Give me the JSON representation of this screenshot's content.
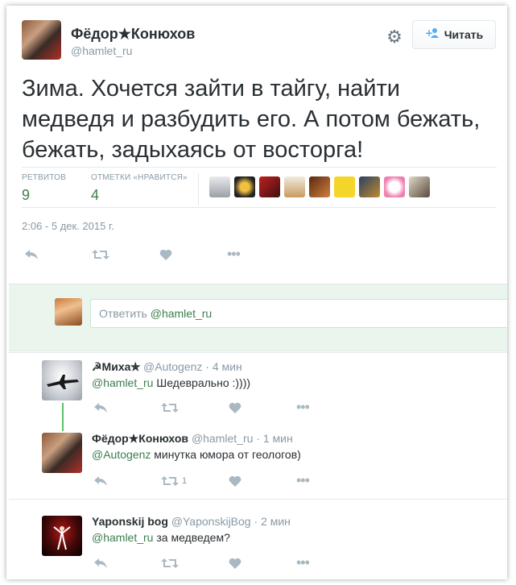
{
  "tweet": {
    "author_name": "Фёдор★Конюхов",
    "author_handle": "@hamlet_ru",
    "follow_label": "Читать",
    "text": "Зима. Хочется зайти в тайгу, найти медведя и разбудить его. А потом бежать, бежать, задыхаясь от восторга!",
    "stats": {
      "retweets_label": "РЕТВИТОВ",
      "retweets_value": "9",
      "likes_label": "ОТМЕТКИ «НРАВИТСЯ»",
      "likes_value": "4"
    },
    "timestamp": "2:06 - 5 дек. 2015 г."
  },
  "reply_box": {
    "prefix": "Ответить ",
    "mention": "@hamlet_ru"
  },
  "replies": [
    {
      "name": "☭Миха✯",
      "handle": "@Autogenz",
      "time": "· 4 мин",
      "mention": "@hamlet_ru",
      "text": " Шедеврально :))))",
      "retweet_count": ""
    },
    {
      "name": "Фёдор★Конюхов",
      "handle": "@hamlet_ru",
      "time": "· 1 мин",
      "mention": "@Autogenz",
      "text": " минутка юмора от геологов)",
      "retweet_count": "1"
    },
    {
      "name": "Yaponskij bog",
      "handle": "@YaponskijBog",
      "time": "· 2 мин",
      "mention": "@hamlet_ru",
      "text": " за медведем?",
      "retweet_count": ""
    }
  ],
  "icons": {
    "reply": "↩",
    "retweet": "⇄",
    "like": "♥",
    "more": "•••",
    "gear": "⚙",
    "follow": "+👤"
  },
  "colors": {
    "accent_green": "#3b7e4e",
    "meta_gray": "#8899a6",
    "reply_box_bg": "#eaf5ee",
    "thread_line": "#5cc16a"
  }
}
